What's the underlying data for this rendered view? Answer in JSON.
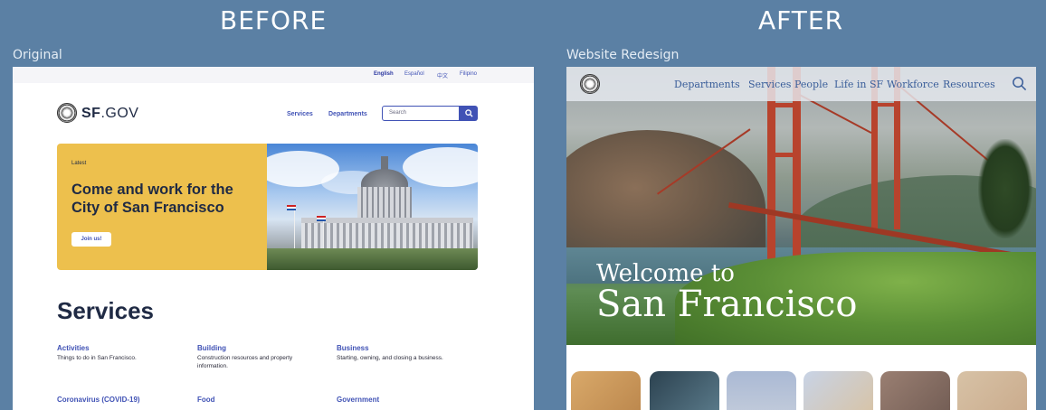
{
  "labels": {
    "before": "BEFORE",
    "after": "AFTER",
    "original": "Original",
    "redesign": "Website Redesign"
  },
  "before": {
    "languages": [
      "English",
      "Español",
      "中文",
      "Filipino"
    ],
    "logo": {
      "bold": "SF",
      "rest": ".GOV"
    },
    "nav": {
      "services": "Services",
      "departments": "Departments"
    },
    "search": {
      "placeholder": "Search"
    },
    "hero": {
      "eyebrow": "Latest",
      "title": "Come and work for the City of San Francisco",
      "button": "Join us!"
    },
    "services_title": "Services",
    "services": [
      {
        "name": "Activities",
        "desc": "Things to do in San Francisco."
      },
      {
        "name": "Building",
        "desc": "Construction resources and property information."
      },
      {
        "name": "Business",
        "desc": "Starting, owning, and closing a business."
      },
      {
        "name": "Coronavirus (COVID-19)",
        "desc": ""
      },
      {
        "name": "Food",
        "desc": ""
      },
      {
        "name": "Government",
        "desc": ""
      }
    ]
  },
  "after": {
    "nav": [
      "Departments",
      "Services",
      "People",
      "Life in SF",
      "Workforce",
      "Resources"
    ],
    "welcome_line1": "Welcome to",
    "welcome_line2": "San Francisco"
  },
  "colors": {
    "background": "#5b80a4",
    "accent": "#4052b5",
    "hero_yellow": "#edc04d",
    "navy": "#1f2a44"
  },
  "icons": {
    "search": "search-icon",
    "seal": "city-seal-icon"
  }
}
